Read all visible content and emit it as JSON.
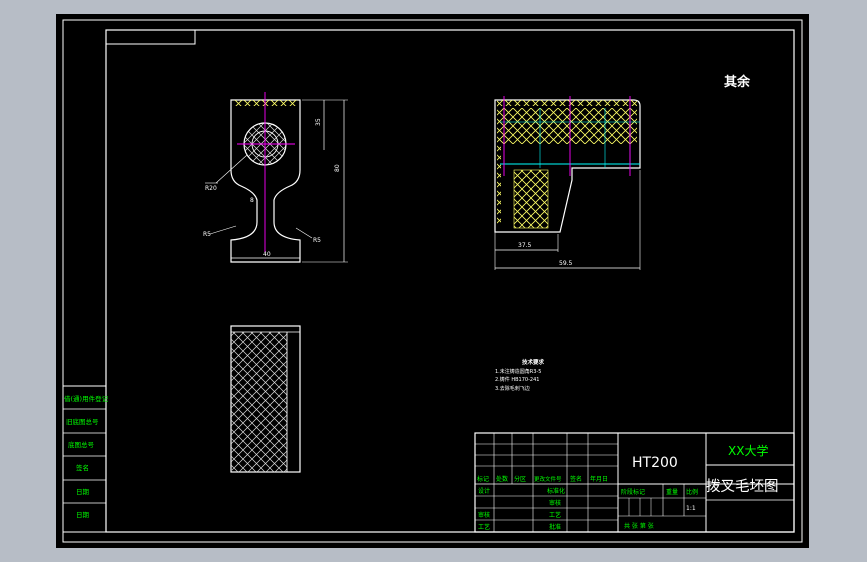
{
  "drawing": {
    "roughness_note": "其余",
    "tech_req": {
      "title": "技术要求",
      "lines": [
        "1.未注铸造圆角R3-5",
        "2.铸件 HB170-241",
        "3.去除毛刺飞边"
      ]
    },
    "dims": {
      "r1": "R20",
      "r2": "R5",
      "r3": "R5",
      "h1": "35",
      "h2": "80",
      "w1": "40",
      "thk": "8",
      "d1": "37.5",
      "d2": "59.5"
    }
  },
  "left_table": [
    "借(通)用件登记",
    "旧底图总号",
    "底图总号",
    "签名",
    "日期",
    "日期"
  ],
  "title_block": {
    "material": "HT200",
    "school": "XX大学",
    "title": "拨叉毛坯图",
    "scale": "1:1",
    "rev_headers": [
      "标记",
      "处数",
      "分区",
      "更改文件号",
      "签名",
      "年月日"
    ],
    "roles": [
      "设计",
      "审核",
      "工艺"
    ],
    "std_labels": [
      "标准化",
      "审核",
      "工艺",
      "批准"
    ],
    "stage_headers": [
      "阶段标记",
      "重量",
      "比例"
    ],
    "sheet": "共  张  第  张"
  },
  "colors": {
    "background": "#b7bdc6",
    "paper": "#000000",
    "line": "#ffffff",
    "center": "#ff00ff",
    "dim": "#ffffff",
    "hatch": "#ffff66",
    "cyan": "#00ffff",
    "label_green": "#00ff00"
  }
}
